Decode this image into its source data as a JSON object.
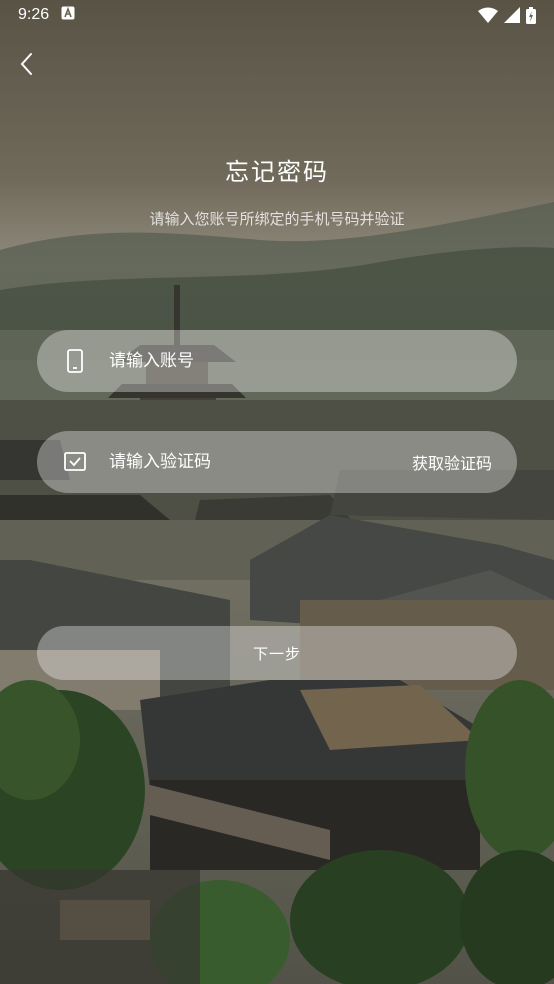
{
  "status_bar": {
    "time": "9:26",
    "notification_icon": "font-a-icon",
    "wifi_icon": "wifi-icon",
    "signal_icon": "cell-signal-icon",
    "battery_icon": "battery-charging-icon"
  },
  "header": {
    "back_icon": "chevron-left-icon",
    "title": "忘记密码",
    "subtitle": "请输入您账号所绑定的手机号码并验证"
  },
  "form": {
    "account": {
      "icon": "phone-icon",
      "placeholder": "请输入账号",
      "value": ""
    },
    "code": {
      "icon": "check-square-icon",
      "placeholder": "请输入验证码",
      "value": "",
      "get_code_label": "获取验证码"
    },
    "next_label": "下一步"
  },
  "colors": {
    "sky": "#6f6a5c",
    "field_bg": "rgba(255,255,255,0.34)",
    "text": "#ffffff"
  }
}
